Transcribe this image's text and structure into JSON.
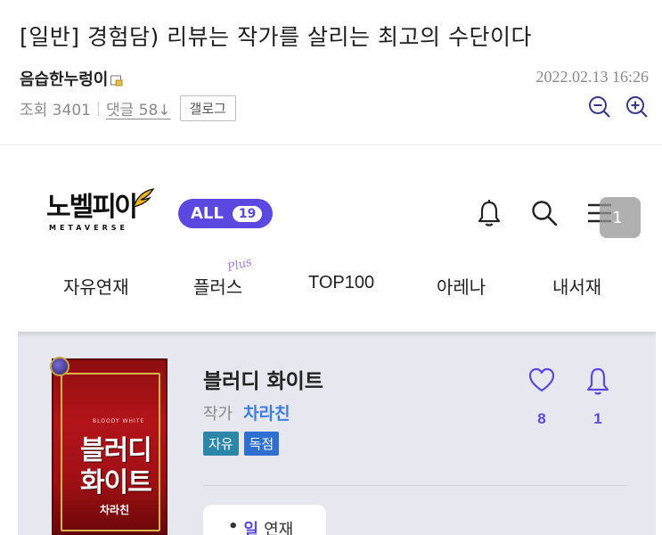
{
  "post": {
    "title": "[일반] 경험담) 리뷰는 작가를 살리는 최고의 수단이다",
    "author": "음습한누렁이",
    "date": "2022.02.13 16:26",
    "views": "조회 3401",
    "comments": "댓글 58↓",
    "gallog_label": "갤로그"
  },
  "app": {
    "logo_text": "노벨피아",
    "logo_sub": "METAVERSE",
    "all_label": "ALL",
    "all_count": "19",
    "menu_badge": "1",
    "nav_tabs": [
      "자유연재",
      "플러스",
      "TOP100",
      "아레나",
      "내서재"
    ],
    "plus_script": "Plus"
  },
  "novel": {
    "title": "블러디 화이트",
    "author_label": "작가",
    "author": "차라친",
    "tags": [
      "자유",
      "독점"
    ],
    "likes": "8",
    "alarms": "1",
    "serial_day": "일",
    "serial_label": "연재",
    "serial_dot": "•",
    "cover": {
      "small_text": "BLOODY WHITE",
      "title_line1": "블러디",
      "title_line2": "화이트",
      "author": "차라친"
    }
  },
  "colors": {
    "accent": "#5a48e0",
    "author_link": "#3d7fe0",
    "tag_free": "#2b86a8",
    "tag_exclusive": "#2f6fcf",
    "cover_red": "#b3141a"
  }
}
